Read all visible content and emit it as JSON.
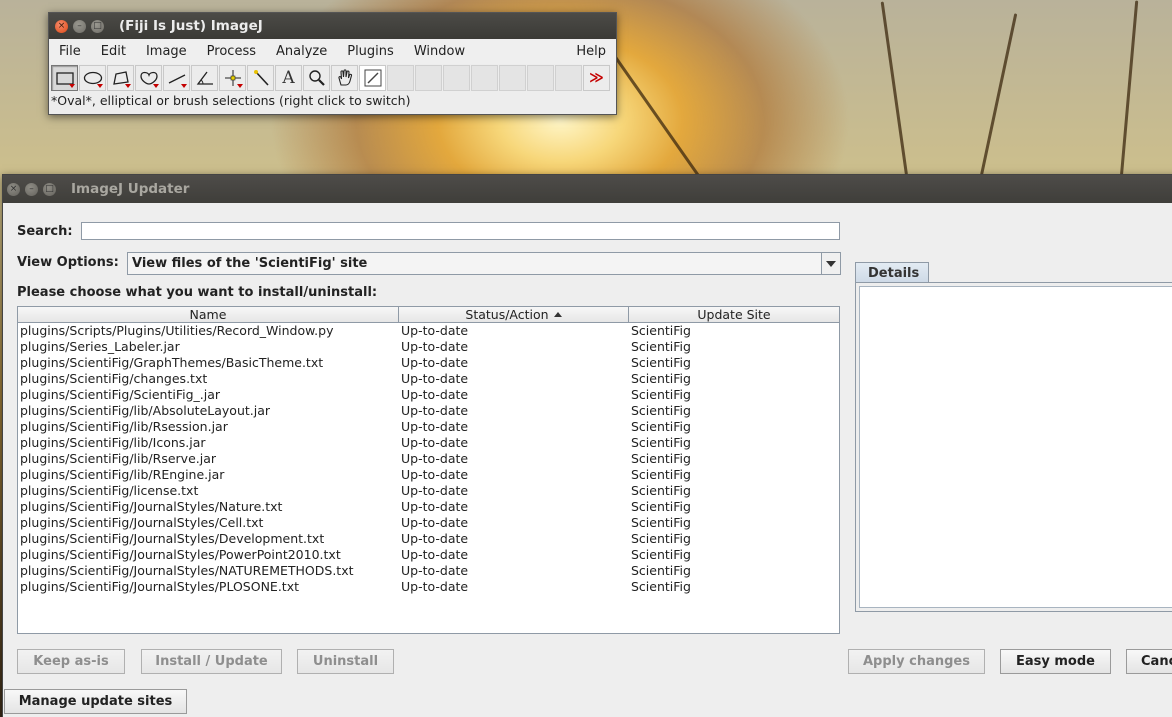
{
  "fiji": {
    "title": "(Fiji Is Just) ImageJ",
    "window_buttons": {
      "close": "×",
      "minimize": "–",
      "maximize": "□"
    },
    "menu": [
      "File",
      "Edit",
      "Image",
      "Process",
      "Analyze",
      "Plugins",
      "Window",
      "Help"
    ],
    "tools": [
      {
        "name": "rectangle-tool",
        "glyph": "▭"
      },
      {
        "name": "oval-tool",
        "glyph": "◯"
      },
      {
        "name": "polygon-tool",
        "glyph": "⬠"
      },
      {
        "name": "freehand-tool",
        "glyph": "♡"
      },
      {
        "name": "line-tool",
        "glyph": "⟋"
      },
      {
        "name": "angle-tool",
        "glyph": "∠"
      },
      {
        "name": "point-tool",
        "glyph": "⌖"
      },
      {
        "name": "wand-tool",
        "glyph": "⁄"
      },
      {
        "name": "text-tool",
        "glyph": "A"
      },
      {
        "name": "magnifier-tool",
        "glyph": "🔍"
      },
      {
        "name": "hand-tool",
        "glyph": "✋"
      },
      {
        "name": "color-picker-tool",
        "glyph": "⬚"
      }
    ],
    "more_tools_glyph": "≫",
    "status": "*Oval*, elliptical or brush selections (right click to switch)"
  },
  "updater": {
    "title": "ImageJ Updater",
    "search_label": "Search:",
    "search_value": "",
    "view_options_label": "View Options:",
    "view_options_value": "View files of the 'ScientiFig' site",
    "instruction": "Please choose what you want to install/uninstall:",
    "columns": [
      "Name",
      "Status/Action",
      "Update Site"
    ],
    "rows": [
      [
        "plugins/Scripts/Plugins/Utilities/Record_Window.py",
        "Up-to-date",
        "ScientiFig"
      ],
      [
        "plugins/Series_Labeler.jar",
        "Up-to-date",
        "ScientiFig"
      ],
      [
        "plugins/ScientiFig/GraphThemes/BasicTheme.txt",
        "Up-to-date",
        "ScientiFig"
      ],
      [
        "plugins/ScientiFig/changes.txt",
        "Up-to-date",
        "ScientiFig"
      ],
      [
        "plugins/ScientiFig/ScientiFig_.jar",
        "Up-to-date",
        "ScientiFig"
      ],
      [
        "plugins/ScientiFig/lib/AbsoluteLayout.jar",
        "Up-to-date",
        "ScientiFig"
      ],
      [
        "plugins/ScientiFig/lib/Rsession.jar",
        "Up-to-date",
        "ScientiFig"
      ],
      [
        "plugins/ScientiFig/lib/Icons.jar",
        "Up-to-date",
        "ScientiFig"
      ],
      [
        "plugins/ScientiFig/lib/Rserve.jar",
        "Up-to-date",
        "ScientiFig"
      ],
      [
        "plugins/ScientiFig/lib/REngine.jar",
        "Up-to-date",
        "ScientiFig"
      ],
      [
        "plugins/ScientiFig/license.txt",
        "Up-to-date",
        "ScientiFig"
      ],
      [
        "plugins/ScientiFig/JournalStyles/Nature.txt",
        "Up-to-date",
        "ScientiFig"
      ],
      [
        "plugins/ScientiFig/JournalStyles/Cell.txt",
        "Up-to-date",
        "ScientiFig"
      ],
      [
        "plugins/ScientiFig/JournalStyles/Development.txt",
        "Up-to-date",
        "ScientiFig"
      ],
      [
        "plugins/ScientiFig/JournalStyles/PowerPoint2010.txt",
        "Up-to-date",
        "ScientiFig"
      ],
      [
        "plugins/ScientiFig/JournalStyles/NATUREMETHODS.txt",
        "Up-to-date",
        "ScientiFig"
      ],
      [
        "plugins/ScientiFig/JournalStyles/PLOSONE.txt",
        "Up-to-date",
        "ScientiFig"
      ]
    ],
    "details_tab": "Details",
    "buttons": {
      "keep": "Keep as-is",
      "install": "Install / Update",
      "uninstall": "Uninstall",
      "apply": "Apply changes",
      "easy": "Easy mode",
      "cancel": "Cancel",
      "manage": "Manage update sites"
    }
  }
}
